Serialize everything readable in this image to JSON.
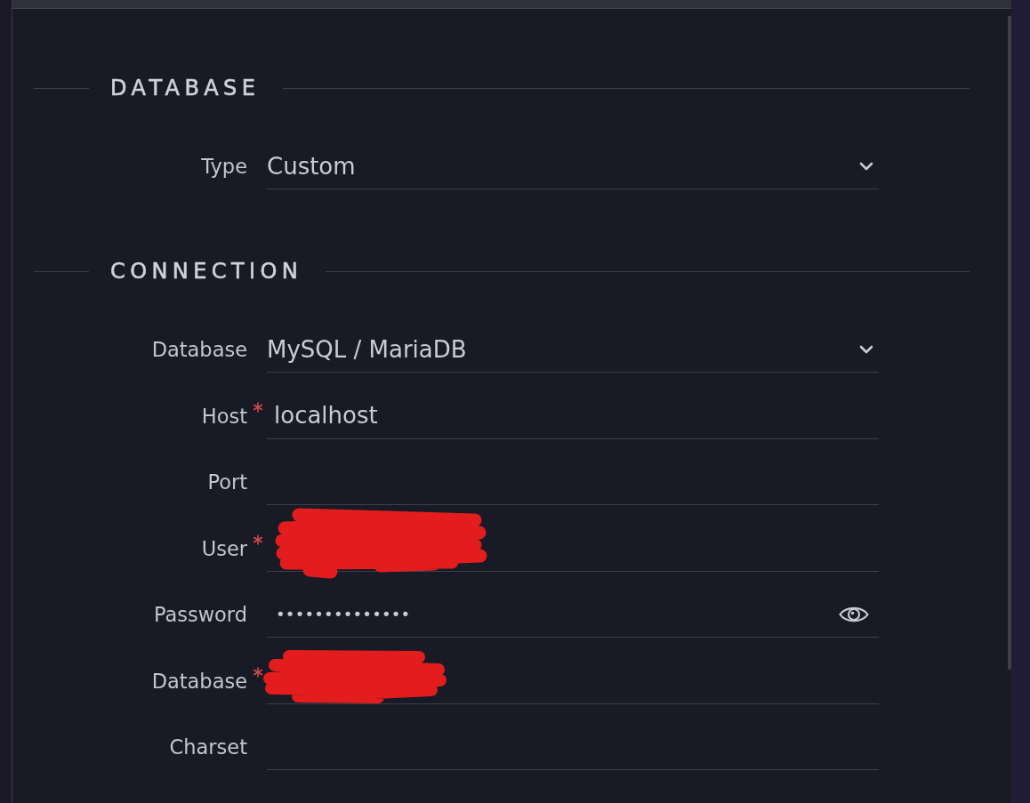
{
  "sections": [
    {
      "title": "DATABASE",
      "fields": [
        {
          "label": "Type",
          "kind": "select",
          "value": "Custom",
          "required": false,
          "redacted": false
        }
      ]
    },
    {
      "title": "CONNECTION",
      "fields": [
        {
          "label": "Database",
          "kind": "select",
          "value": "MySQL / MariaDB",
          "required": false,
          "redacted": false
        },
        {
          "label": "Host",
          "kind": "text",
          "value": "localhost",
          "required": true,
          "redacted": false
        },
        {
          "label": "Port",
          "kind": "text",
          "required": false,
          "redacted": false
        },
        {
          "label": "User",
          "kind": "text",
          "required": true,
          "redacted": true
        },
        {
          "label": "Password",
          "kind": "password",
          "value": "••••••••••••••",
          "required": false,
          "redacted": false
        },
        {
          "label": "Database",
          "kind": "text",
          "required": true,
          "redacted": true
        },
        {
          "label": "Charset",
          "kind": "text",
          "required": false,
          "redacted": false
        }
      ]
    }
  ]
}
